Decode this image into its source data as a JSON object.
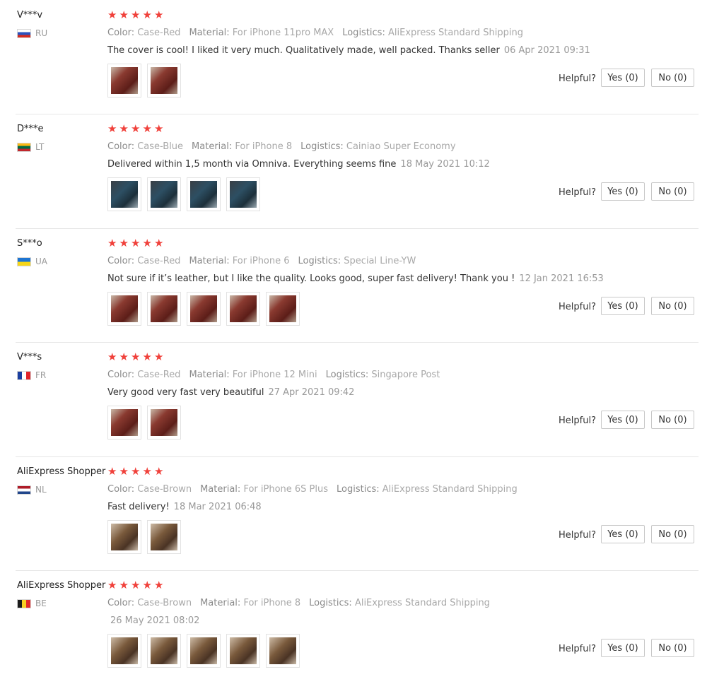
{
  "labels": {
    "color": "Color:",
    "material": "Material:",
    "logistics": "Logistics:",
    "helpful": "Helpful?",
    "yes": "Yes (0)",
    "no": "No (0)"
  },
  "colors": {
    "star": "#f0413b",
    "photo_red": "#7a2a22",
    "photo_blue": "#2d4f63",
    "photo_brown": "#7a5a3c"
  },
  "reviews": [
    {
      "user": "V***v",
      "country": "RU",
      "rating": 5,
      "color": "Case-Red",
      "material": "For iPhone 11pro MAX",
      "logistics": "AliExpress Standard Shipping",
      "text": "The cover is cool! I liked it very much. Qualitatively made, well packed. Thanks seller",
      "date": "06 Apr 2021 09:31",
      "photos": [
        "red-case-photo",
        "red-case-photo"
      ]
    },
    {
      "user": "D***e",
      "country": "LT",
      "rating": 5,
      "color": "Case-Blue",
      "material": "For iPhone 8",
      "logistics": "Cainiao Super Economy",
      "text": "Delivered within 1,5 month via Omniva. Everything seems fine",
      "date": "18 May 2021 10:12",
      "photos": [
        "blue-case-photo",
        "blue-case-photo",
        "blue-case-photo",
        "blue-case-photo"
      ]
    },
    {
      "user": "S***o",
      "country": "UA",
      "rating": 5,
      "color": "Case-Red",
      "material": "For iPhone 6",
      "logistics": "Special Line-YW",
      "text": "Not sure if it’s leather, but I like the quality. Looks good, super fast delivery! Thank you !",
      "date": "12 Jan 2021 16:53",
      "photos": [
        "red-case-photo",
        "red-case-photo",
        "red-case-photo",
        "red-case-photo",
        "red-case-photo"
      ]
    },
    {
      "user": "V***s",
      "country": "FR",
      "rating": 5,
      "color": "Case-Red",
      "material": "For iPhone 12 Mini",
      "logistics": "Singapore Post",
      "text": "Very good very fast very beautiful",
      "date": "27 Apr 2021 09:42",
      "photos": [
        "red-case-photo",
        "red-case-photo"
      ]
    },
    {
      "user": "AliExpress Shopper",
      "country": "NL",
      "rating": 5,
      "color": "Case-Brown",
      "material": "For iPhone 6S Plus",
      "logistics": "AliExpress Standard Shipping",
      "text": "Fast delivery!",
      "date": "18 Mar 2021 06:48",
      "photos": [
        "brown-case-photo",
        "brown-case-photo"
      ]
    },
    {
      "user": "AliExpress Shopper",
      "country": "BE",
      "rating": 5,
      "color": "Case-Brown",
      "material": "For iPhone 8",
      "logistics": "AliExpress Standard Shipping",
      "text": "",
      "date": "26 May 2021 08:02",
      "photos": [
        "brown-case-photo",
        "brown-case-photo",
        "brown-case-photo",
        "brown-case-photo",
        "brown-case-photo"
      ]
    }
  ]
}
